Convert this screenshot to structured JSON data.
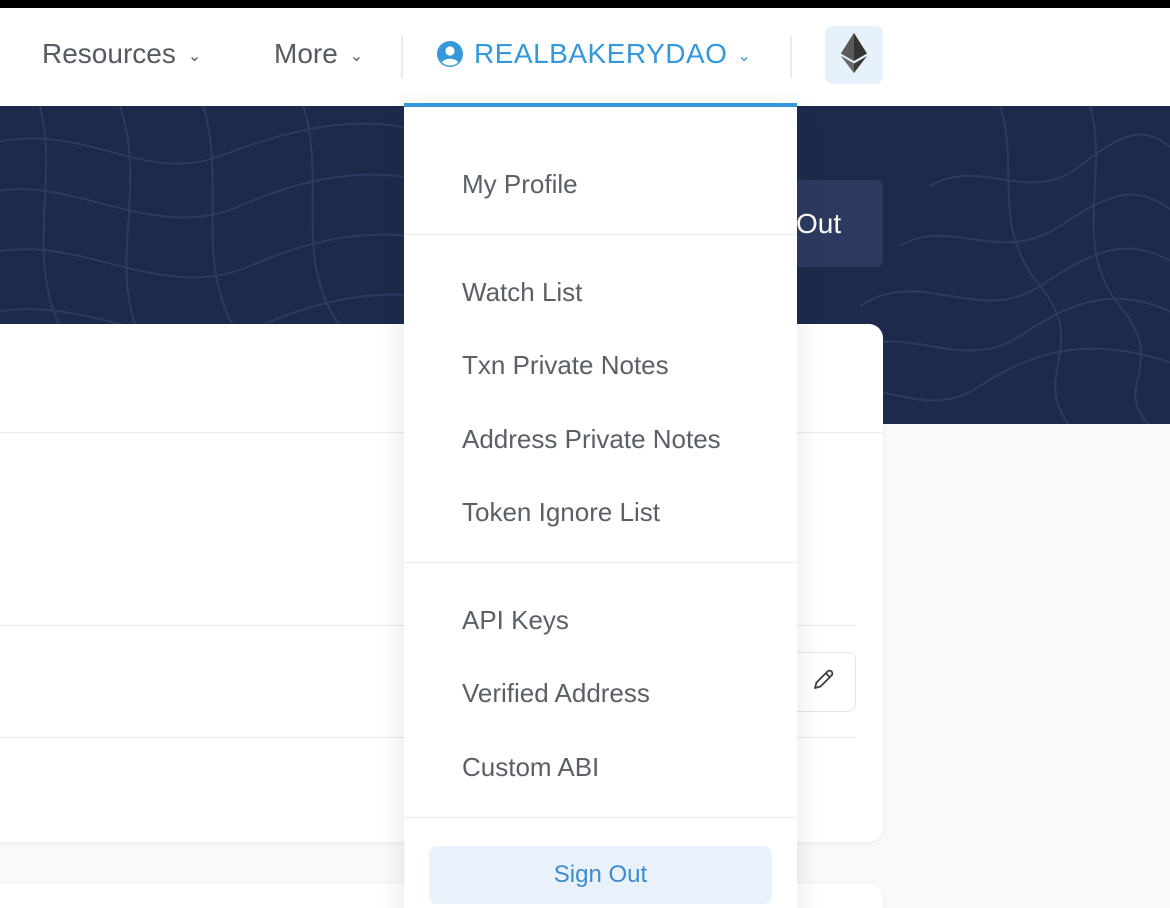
{
  "navbar": {
    "resources_label": "Resources",
    "more_label": "More",
    "user_label": "REALBAKERYDAO"
  },
  "hero": {
    "button_label": "Out"
  },
  "dropdown": {
    "items": [
      {
        "label": "My Profile"
      },
      {
        "label": "Watch List"
      },
      {
        "label": "Txn Private Notes"
      },
      {
        "label": "Address Private Notes"
      },
      {
        "label": "Token Ignore List"
      },
      {
        "label": "API Keys"
      },
      {
        "label": "Verified Address"
      },
      {
        "label": "Custom ABI"
      }
    ],
    "sign_out_label": "Sign Out"
  },
  "colors": {
    "accent": "#3498db",
    "hero_bg": "#1d2a4c",
    "sign_out_bg": "#e9f1fa"
  },
  "icons": {
    "user": "user-circle-icon",
    "network": "ethereum-icon",
    "edit": "pencil-icon",
    "caret": "chevron-down-icon"
  }
}
